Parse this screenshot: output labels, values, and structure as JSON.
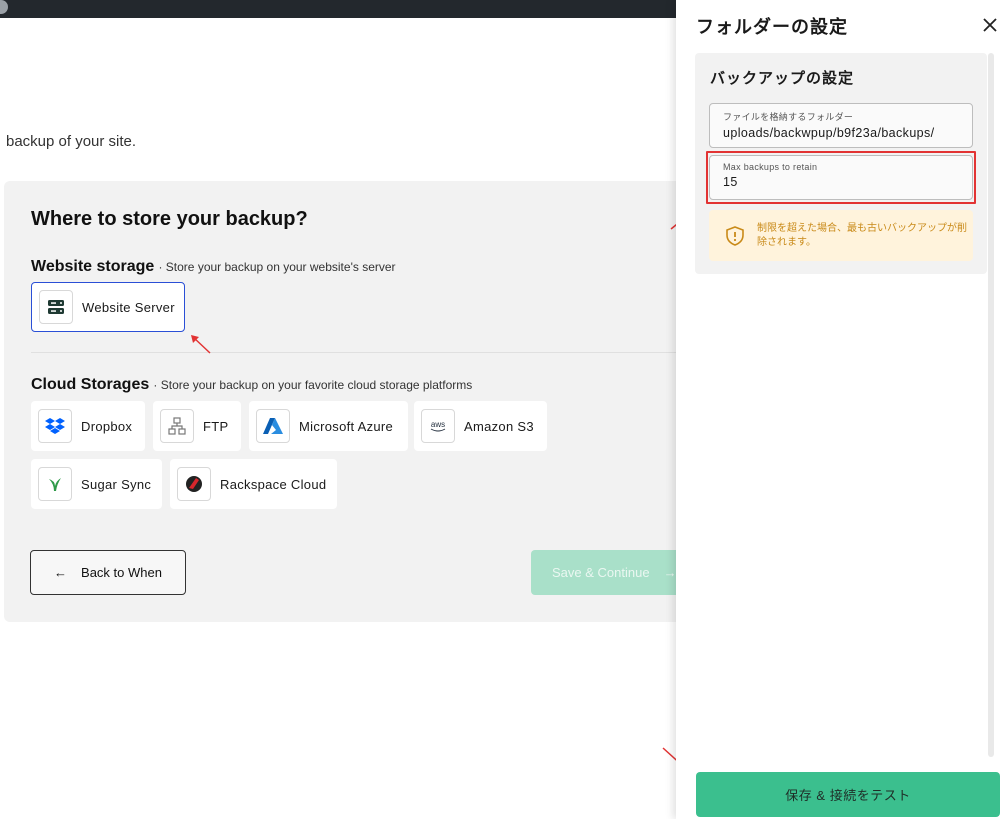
{
  "intro_text": "backup of your site.",
  "storage": {
    "title": "Where to store your backup?",
    "website_section": {
      "title": "Website storage",
      "description": "· Store your backup on your website's server",
      "tiles": [
        {
          "label": "Website Server",
          "icon": "server-icon",
          "selected": true
        }
      ]
    },
    "cloud_section": {
      "title": "Cloud Storages",
      "description": "· Store your backup on your favorite cloud storage platforms",
      "tiles": [
        {
          "label": "Dropbox",
          "icon": "dropbox-icon"
        },
        {
          "label": "FTP",
          "icon": "ftp-network-icon"
        },
        {
          "label": "Microsoft Azure",
          "icon": "azure-icon"
        },
        {
          "label": "Amazon S3",
          "icon": "aws-icon"
        },
        {
          "label": "Sugar Sync",
          "icon": "sugarsync-icon"
        },
        {
          "label": "Rackspace Cloud",
          "icon": "rackspace-icon"
        }
      ]
    },
    "back_button": {
      "label": "Back to When",
      "arrow": "←"
    },
    "save_button": {
      "label": "Save & Continue",
      "arrow": "→"
    }
  },
  "drawer": {
    "title": "フォルダーの設定",
    "card_title": "バックアップの設定",
    "folder_field": {
      "label": "ファイルを格納するフォルダー",
      "value": "uploads/backwpup/b9f23a/backups/"
    },
    "max_backups_field": {
      "label": "Max backups to retain",
      "value": "15"
    },
    "warning_text": "制限を超えた場合、最も古いバックアップが削除されます。",
    "primary_button": "保存 & 接続をテスト"
  },
  "colors": {
    "accent_green": "#3bbf8e",
    "selected_border": "#2a4fd6",
    "annotation_red": "#e23333",
    "warning_bg": "#fff3dc",
    "warning_text": "#c98a18"
  }
}
